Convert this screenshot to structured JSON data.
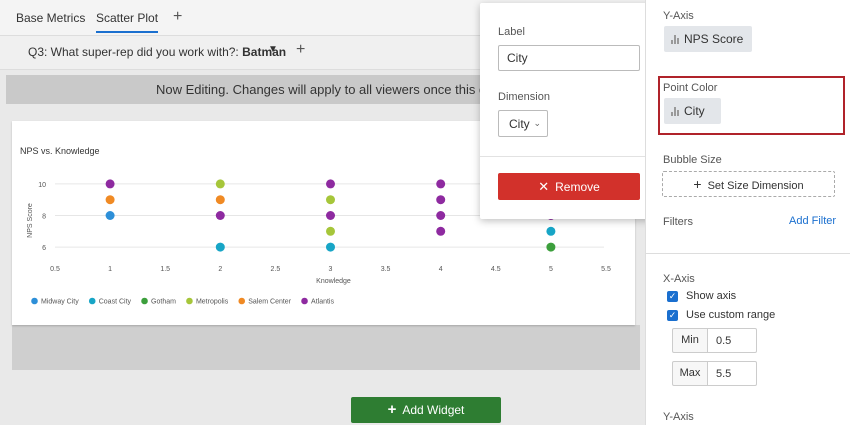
{
  "tabs": [
    {
      "label": "Base Metrics",
      "active": false
    },
    {
      "label": "Scatter Plot",
      "active": true
    }
  ],
  "filter": {
    "question": "Q3: What super-rep did you work with?:",
    "value": "Batman"
  },
  "banner": {
    "text": "Now Editing. Changes will apply to all viewers once this dashb"
  },
  "widget": {
    "title": "NPS vs. Knowledge"
  },
  "add_widget": {
    "label": "Add Widget"
  },
  "popup": {
    "label_heading": "Label",
    "label_value": "City",
    "dimension_heading": "Dimension",
    "dimension_value": "City",
    "remove_label": "Remove"
  },
  "panel": {
    "y_axis_heading": "Y-Axis",
    "y_axis_value": "NPS Score",
    "point_color_heading": "Point Color",
    "point_color_value": "City",
    "bubble_size_heading": "Bubble Size",
    "set_size_label": "Set Size Dimension",
    "filters_heading": "Filters",
    "add_filter_label": "Add Filter",
    "x_axis_heading": "X-Axis",
    "show_axis_label": "Show axis",
    "custom_range_label": "Use custom range",
    "min_label": "Min",
    "min_value": "0.5",
    "max_label": "Max",
    "max_value": "5.5",
    "y_axis_bottom_heading": "Y-Axis"
  },
  "colors": {
    "accent": "#1a6fcf",
    "remove": "#d2312b",
    "add_widget": "#2e7d32",
    "highlight": "#b0232a"
  },
  "chart_data": {
    "type": "scatter",
    "title": "NPS vs. Knowledge",
    "xlabel": "Knowledge",
    "ylabel": "NPS Score",
    "xlim": [
      0.5,
      5.5
    ],
    "ylim": [
      5.5,
      10.5
    ],
    "x_ticks": [
      "0.5",
      "1",
      "1.5",
      "2",
      "2.5",
      "3",
      "3.5",
      "4",
      "4.5",
      "5",
      "5.5"
    ],
    "y_ticks": [
      "6",
      "8",
      "10"
    ],
    "grid": true,
    "legend_placement": "bottom-left",
    "series": [
      {
        "name": "Midway City",
        "color": "#2d8fd8",
        "points": [
          [
            1,
            8
          ]
        ]
      },
      {
        "name": "Coast City",
        "color": "#17a5c6",
        "points": [
          [
            2,
            6
          ],
          [
            3,
            6
          ],
          [
            5,
            7
          ]
        ]
      },
      {
        "name": "Gotham",
        "color": "#3c9f3c",
        "points": [
          [
            5,
            6
          ]
        ]
      },
      {
        "name": "Metropolis",
        "color": "#a6c63a",
        "points": [
          [
            2,
            10
          ],
          [
            3,
            9
          ],
          [
            3,
            7
          ]
        ]
      },
      {
        "name": "Salem Center",
        "color": "#f08a24",
        "points": [
          [
            1,
            9
          ],
          [
            2,
            9
          ]
        ]
      },
      {
        "name": "Atlantis",
        "color": "#8e2aa0",
        "points": [
          [
            1,
            10
          ],
          [
            2,
            8
          ],
          [
            3,
            10
          ],
          [
            3,
            8
          ],
          [
            4,
            10
          ],
          [
            4,
            9
          ],
          [
            4,
            8
          ],
          [
            4,
            7
          ],
          [
            5,
            8
          ]
        ]
      }
    ]
  }
}
